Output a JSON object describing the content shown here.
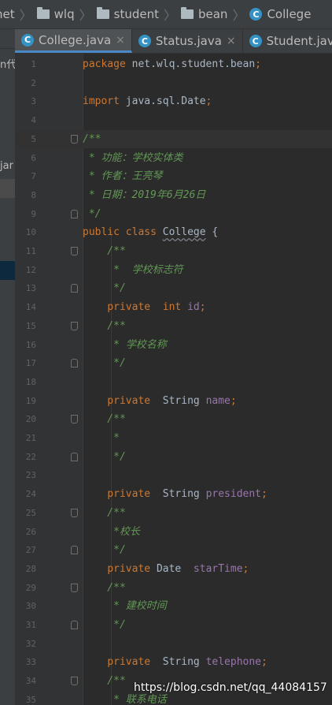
{
  "breadcrumb": [
    {
      "label": "net",
      "icon": "folder-icon"
    },
    {
      "label": "wlq",
      "icon": "folder-icon"
    },
    {
      "label": "student",
      "icon": "folder-icon"
    },
    {
      "label": "bean",
      "icon": "folder-icon"
    },
    {
      "label": "College",
      "icon": "class-icon"
    }
  ],
  "project_panel": {
    "fragments": [
      "n代",
      "jar"
    ]
  },
  "tabs": [
    {
      "label": "College.java",
      "active": true,
      "close": "×"
    },
    {
      "label": "Status.java",
      "active": false,
      "close": "×"
    },
    {
      "label": "Student.java",
      "active": false,
      "close": ""
    }
  ],
  "editor": {
    "current_line": 5,
    "lines": [
      {
        "n": "1",
        "text": "package net.wlq.student.bean;"
      },
      {
        "n": "2",
        "text": ""
      },
      {
        "n": "3",
        "text": "import java.sql.Date;"
      },
      {
        "n": "4",
        "text": ""
      },
      {
        "n": "5",
        "text": "/**"
      },
      {
        "n": "6",
        "text": " * 功能：学校实体类"
      },
      {
        "n": "7",
        "text": " * 作者：王亮琴"
      },
      {
        "n": "8",
        "text": " * 日期：2019年6月26日"
      },
      {
        "n": "9",
        "text": " */"
      },
      {
        "n": "10",
        "text": "public class College {"
      },
      {
        "n": "11",
        "text": "    /**"
      },
      {
        "n": "12",
        "text": "     *  学校标志符"
      },
      {
        "n": "13",
        "text": "     */"
      },
      {
        "n": "14",
        "text": "    private  int id;"
      },
      {
        "n": "15",
        "text": "    /**"
      },
      {
        "n": "16",
        "text": "     * 学校名称"
      },
      {
        "n": "17",
        "text": "     */"
      },
      {
        "n": "18",
        "text": ""
      },
      {
        "n": "19",
        "text": "    private  String name;"
      },
      {
        "n": "20",
        "text": "    /**"
      },
      {
        "n": "21",
        "text": "     *"
      },
      {
        "n": "22",
        "text": "     */"
      },
      {
        "n": "23",
        "text": ""
      },
      {
        "n": "24",
        "text": "    private  String president;"
      },
      {
        "n": "25",
        "text": "    /**"
      },
      {
        "n": "26",
        "text": "     *校长"
      },
      {
        "n": "27",
        "text": "     */"
      },
      {
        "n": "28",
        "text": "    private Date  starTime;"
      },
      {
        "n": "29",
        "text": "    /**"
      },
      {
        "n": "30",
        "text": "     * 建校时间"
      },
      {
        "n": "31",
        "text": "     */"
      },
      {
        "n": "32",
        "text": ""
      },
      {
        "n": "33",
        "text": "    private  String telephone;"
      },
      {
        "n": "34",
        "text": "    /**"
      },
      {
        "n": "35",
        "text": "     * 联系电话"
      }
    ]
  },
  "watermark": "https://blog.csdn.net/qq_44084157",
  "colors": {
    "keyword": "#cc7832",
    "doc_comment": "#629755",
    "field": "#9876aa",
    "plain": "#a9b7c6",
    "accent": "#4a88c7"
  }
}
